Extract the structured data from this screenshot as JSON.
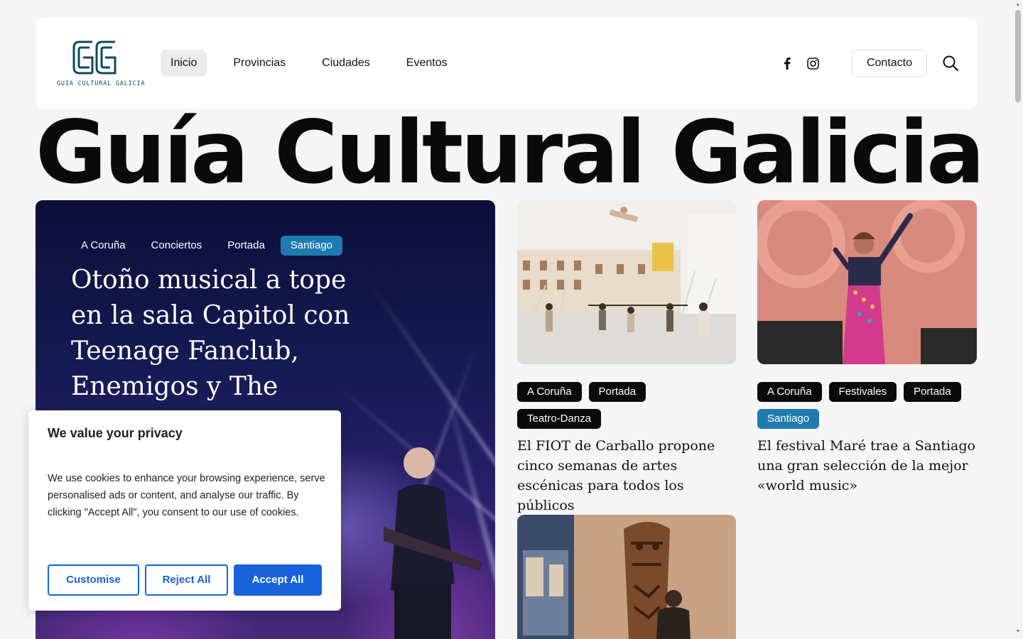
{
  "header": {
    "logo_text": "GUIA CULTURAL GALICIA",
    "nav": [
      {
        "label": "Inicio",
        "active": true
      },
      {
        "label": "Provincias",
        "active": false
      },
      {
        "label": "Ciudades",
        "active": false
      },
      {
        "label": "Eventos",
        "active": false
      }
    ],
    "social_icons": [
      "facebook-icon",
      "instagram-icon"
    ],
    "contact_label": "Contacto",
    "search_icon": "search-icon"
  },
  "hero": {
    "title": "Guía Cultural Galicia"
  },
  "feature": {
    "tags": [
      "A Coruña",
      "Conciertos",
      "Portada",
      "Santiago"
    ],
    "title": "Otoño musical a tope en la sala Capitol con Teenage Fanclub, Enemigos y The"
  },
  "cards": [
    {
      "tags": [
        "A Coruña",
        "Portada",
        "Teatro-Danza"
      ],
      "title": "El FIOT de Carballo propone cinco semanas de artes escénicas para todos los públicos"
    },
    {
      "tags": [
        "A Coruña",
        "Festivales",
        "Portada",
        "Santiago"
      ],
      "title": "El festival Maré trae a Santiago una gran selección de la mejor «world music»"
    }
  ],
  "cookie": {
    "title": "We value your privacy",
    "text": "We use cookies to enhance your browsing experience, serve personalised ads or content, and analyse our traffic. By clicking \"Accept All\", you consent to our use of cookies.",
    "customise": "Customise",
    "reject": "Reject All",
    "accept": "Accept All"
  },
  "colors": {
    "accent_blue": "#1e7bb0",
    "cookie_blue": "#1863dc",
    "logo_teal": "#0c4a5c"
  }
}
